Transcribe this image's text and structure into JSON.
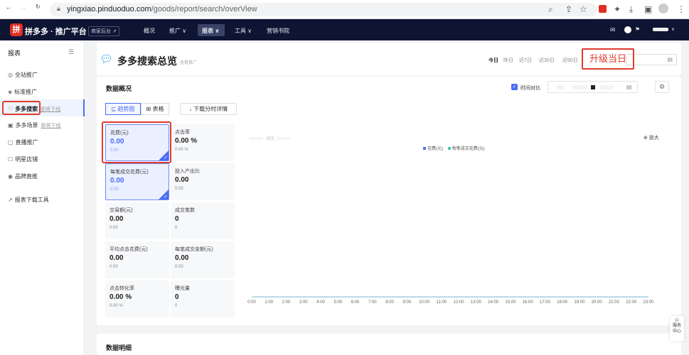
{
  "browser": {
    "url_domain": "yingxiao.pinduoduo.com",
    "url_path": "/goods/report/search/overView"
  },
  "appbar": {
    "logo_glyph": "拼",
    "brand": "拼多多 · 推广平台",
    "merchant_label": "商家后台 ↗",
    "nav": [
      {
        "label": "概况"
      },
      {
        "label": "推广 ∨"
      },
      {
        "label": "报表 ∨"
      },
      {
        "label": "工具 ∨"
      },
      {
        "label": "营销书院"
      }
    ]
  },
  "sidebar": {
    "title": "报表",
    "items": [
      {
        "label": "全站推广",
        "icon": "◎",
        "tag": ""
      },
      {
        "label": "标准推广",
        "icon": "◈",
        "tag": ""
      },
      {
        "label": "多多搜索",
        "icon": "♡",
        "tag": "即将下线"
      },
      {
        "label": "多多场景",
        "icon": "▣",
        "tag": "即将下线"
      },
      {
        "label": "直播推广",
        "icon": "▢",
        "tag": ""
      },
      {
        "label": "明星店铺",
        "icon": "☐",
        "tag": ""
      },
      {
        "label": "品牌直推",
        "icon": "◉",
        "tag": ""
      },
      {
        "label": "报表下载工具",
        "icon": "↗",
        "tag": ""
      }
    ]
  },
  "header": {
    "title": "多多搜索总览",
    "subtitle": "查看推广",
    "date_tabs": [
      "今日",
      "昨日",
      "近7日",
      "近30日",
      "近90日"
    ],
    "annotation": "升级当日"
  },
  "overview": {
    "title": "数据概况",
    "compare_label": "时间对比",
    "view_trend": "⊑ 趋势图",
    "view_table": "⊞ 表格",
    "download": "↓ 下载分时详情",
    "metrics": [
      {
        "label": "花费(元)",
        "value": "0.00",
        "sub": "0.00",
        "selected": true
      },
      {
        "label": "点击率",
        "value": "0.00 %",
        "sub": "0.00 %",
        "selected": false
      },
      {
        "label": "每笔成交花费(元)",
        "value": "0.00",
        "sub": "0.00",
        "selected": true
      },
      {
        "label": "投入产出比",
        "value": "0.00",
        "sub": "0.00",
        "selected": false
      },
      {
        "label": "交易额(元)",
        "value": "0.00",
        "sub": "0.00",
        "selected": false
      },
      {
        "label": "成交笔数",
        "value": "0",
        "sub": "0",
        "selected": false
      },
      {
        "label": "平均点击花费(元)",
        "value": "0.00",
        "sub": "0.00",
        "selected": false
      },
      {
        "label": "每笔成交金额(元)",
        "value": "0.00",
        "sub": "0.00",
        "selected": false
      },
      {
        "label": "点击转化率",
        "value": "0.00 %",
        "sub": "0.00 %",
        "selected": false
      },
      {
        "label": "曝光量",
        "value": "0",
        "sub": "0",
        "selected": false
      }
    ]
  },
  "chart_data": {
    "type": "line",
    "x": [
      "0:00",
      "1:00",
      "2:00",
      "3:00",
      "4:00",
      "5:00",
      "6:00",
      "7:00",
      "8:00",
      "9:00",
      "10:00",
      "11:00",
      "12:00",
      "13:00",
      "14:00",
      "15:00",
      "16:00",
      "17:00",
      "18:00",
      "19:00",
      "20:00",
      "21:00",
      "22:00",
      "23:00"
    ],
    "series": [
      {
        "name": "花费(元)",
        "color": "#4a6cf7",
        "values": [
          0,
          0,
          0,
          0,
          0,
          0,
          0,
          0,
          0,
          0,
          0,
          0,
          0,
          0,
          0,
          0,
          0,
          0,
          0,
          0,
          0,
          0,
          0,
          0
        ]
      },
      {
        "name": "每笔成交花费(元)",
        "color": "#3cc3b2",
        "values": [
          0,
          0,
          0,
          0,
          0,
          0,
          0,
          0,
          0,
          0,
          0,
          0,
          0,
          0,
          0,
          0,
          0,
          0,
          0,
          0,
          0,
          0,
          0,
          0
        ]
      }
    ],
    "compare_text": "对比",
    "zoom_label": "⊕ 放大",
    "grid": false,
    "legend_position": "top-center"
  },
  "detail": {
    "title": "数据明细"
  },
  "service": {
    "line1": "服务",
    "line2": "中心"
  }
}
